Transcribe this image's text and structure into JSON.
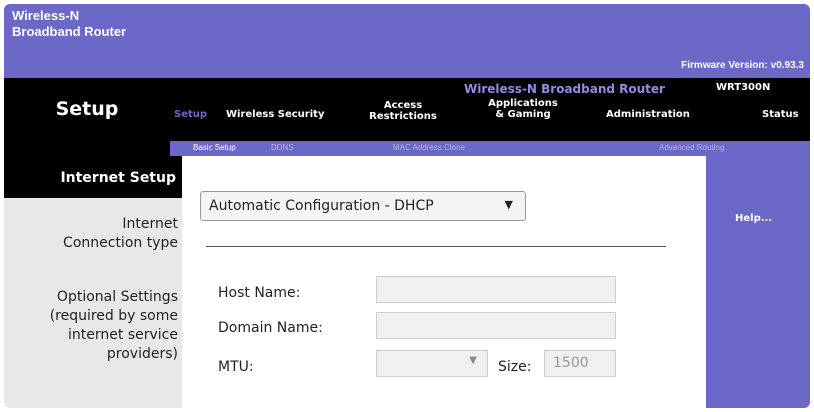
{
  "brand": {
    "line1": "Wireless-N",
    "line2": "Broadband Router"
  },
  "firmware": "Firmware Version: v0.93.3",
  "product_name": "Wireless-N Broadband Router",
  "model": "WRT300N",
  "section_title": "Setup",
  "tabs": {
    "setup": "Setup",
    "wireless_security": "Wireless Security",
    "access_line1": "Access",
    "access_line2": "Restrictions",
    "apps_line1": "Applications",
    "apps_line2": "& Gaming",
    "administration": "Administration",
    "status": "Status"
  },
  "subtabs": {
    "basic_setup": "Basic Setup",
    "ddns": "DDNS",
    "mac_clone": "MAC Address Clone",
    "advanced_routing": "Advanced Routing"
  },
  "internet_setup_title": "Internet Setup",
  "labels": {
    "connection_line1": "Internet",
    "connection_line2": "Connection type",
    "optional_line1": "Optional Settings",
    "optional_line2": "(required by some",
    "optional_line3": "internet service",
    "optional_line4": "providers)"
  },
  "connection_type": "Automatic Configuration - DHCP",
  "fields": {
    "host_name": "Host Name:",
    "domain_name": "Domain Name:",
    "mtu": "MTU:",
    "size_label": "Size:",
    "size_value": "1500"
  },
  "help": "Help...",
  "colors": {
    "accent": "#6b68c7",
    "black": "#000000",
    "panel": "#e8e8e8"
  }
}
